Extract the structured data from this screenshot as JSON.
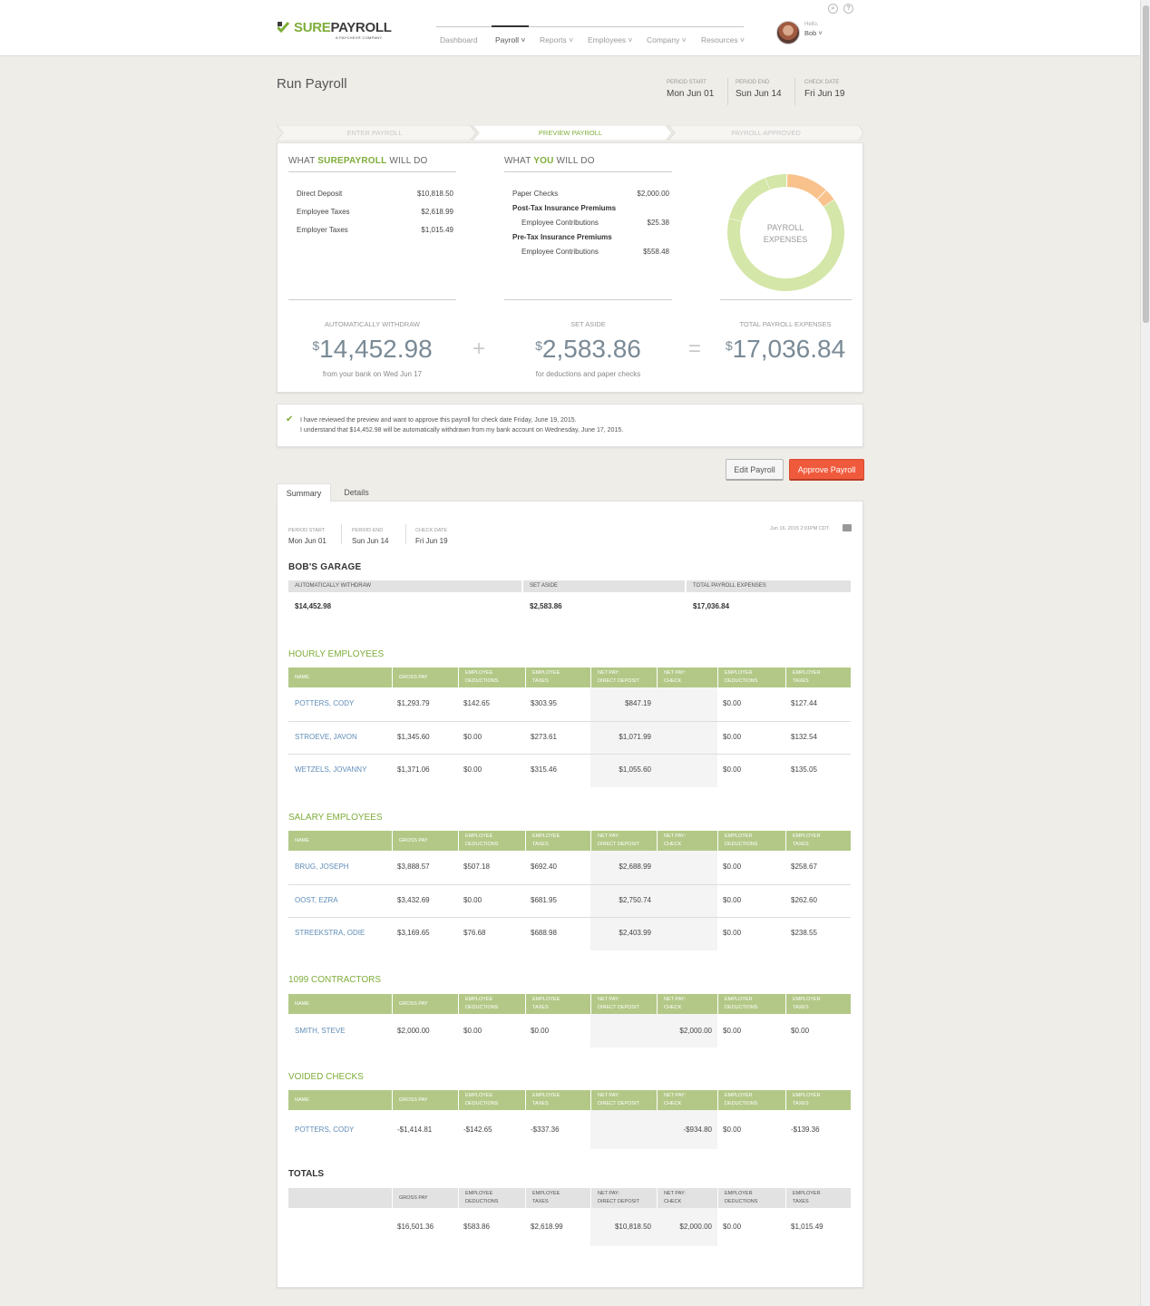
{
  "header": {
    "logo_sure": "SURE",
    "logo_payroll": "PAYROLL",
    "logo_sub": "A PAYCHEX® COMPANY",
    "nav": [
      {
        "label": "Dashboard"
      },
      {
        "label": "Payroll ˅"
      },
      {
        "label": "Reports ˅"
      },
      {
        "label": "Employees ˅"
      },
      {
        "label": "Company ˅"
      },
      {
        "label": "Resources ˅"
      }
    ],
    "hello": "Hello,",
    "user": "Bob ˅",
    "search_glyph": "⌕",
    "help_glyph": "?"
  },
  "page": {
    "title": "Run Payroll",
    "period_start_label": "PERIOD START",
    "period_start": "Mon Jun 01",
    "period_end_label": "PERIOD END",
    "period_end": "Sun Jun 14",
    "check_date_label": "CHECK DATE",
    "check_date": "Fri Jun 19"
  },
  "steps": [
    "ENTER PAYROLL",
    "PREVIEW PAYROLL",
    "PAYROLL APPROVED"
  ],
  "overview": {
    "sp_head_pre": "WHAT ",
    "sp_head_brand": "SUREPAYROLL",
    "sp_head_post": " WILL DO",
    "sp_rows": [
      {
        "label": "Direct Deposit",
        "value": "$10,818.50"
      },
      {
        "label": "Employee Taxes",
        "value": "$2,618.99"
      },
      {
        "label": "Employer Taxes",
        "value": "$1,015.49"
      }
    ],
    "you_head_pre": "WHAT ",
    "you_head_brand": "YOU",
    "you_head_post": " WILL DO",
    "you_rows": {
      "paper_checks_label": "Paper Checks",
      "paper_checks_value": "$2,000.00",
      "post_tax_label": "Post-Tax Insurance Premiums",
      "post_tax_contrib_label": "Employee Contributions",
      "post_tax_contrib_value": "$25.38",
      "pre_tax_label": "Pre-Tax Insurance Premiums",
      "pre_tax_contrib_label": "Employee Contributions",
      "pre_tax_contrib_value": "$558.48"
    },
    "donut_label_1": "PAYROLL",
    "donut_label_2": "EXPENSES",
    "withdraw_label": "AUTOMATICALLY WITHDRAW",
    "withdraw_value": "14,452.98",
    "withdraw_sub": "from your bank on Wed Jun 17",
    "plus": "+",
    "aside_label": "SET ASIDE",
    "aside_value": "2,583.86",
    "aside_sub": "for deductions and paper checks",
    "equals": "=",
    "total_label": "TOTAL PAYROLL EXPENSES",
    "total_value": "17,036.84",
    "currency": "$"
  },
  "chart_data": {
    "type": "pie",
    "title": "PAYROLL EXPENSES",
    "categories": [
      "Direct Deposit",
      "Employee Taxes",
      "Employer Taxes",
      "Paper Checks",
      "Post-Tax Employee Contributions",
      "Pre-Tax Employee Contributions"
    ],
    "values": [
      10818.5,
      2618.99,
      1015.49,
      2000.0,
      25.38,
      558.48
    ],
    "colors": [
      "#d4e6a8",
      "#d4e6a8",
      "#d4e6a8",
      "#f9c28c",
      "#f9c28c",
      "#f9c28c"
    ]
  },
  "confirm": {
    "check_glyph": "✔",
    "line1": "I have reviewed the preview and want to approve this payroll for check date Friday, June 19, 2015.",
    "line2": "I understand that $14,452.98 will be automatically withdrawn from my bank account on Wednesday, June 17, 2015."
  },
  "buttons": {
    "edit": "Edit Payroll",
    "approve": "Approve Payroll"
  },
  "tabs": [
    "Summary",
    "Details"
  ],
  "summary": {
    "period_start_label": "PERIOD START",
    "period_start": "Mon Jun 01",
    "period_end_label": "PERIOD END",
    "period_end": "Sun Jun 14",
    "check_date_label": "CHECK DATE",
    "check_date": "Fri Jun 19",
    "timestamp": "Jun 16, 2015 2:01PM CDT",
    "company": "BOB'S GARAGE",
    "totals_headers": [
      "AUTOMATICALLY WITHDRAW",
      "SET ASIDE",
      "TOTAL PAYROLL EXPENSES"
    ],
    "totals_values": [
      "$14,452.98",
      "$2,583.86",
      "$17,036.84"
    ]
  },
  "columns": {
    "name": "NAME",
    "gross": "GROSS PAY",
    "ee_ded_1": "EMPLOYEE",
    "ee_ded_2": "DEDUCTIONS",
    "ee_tax_1": "EMPLOYEE",
    "ee_tax_2": "TAXES",
    "net_dd_1": "NET PAY:",
    "net_dd_2": "DIRECT DEPOSIT",
    "net_ck_1": "NET PAY:",
    "net_ck_2": "CHECK",
    "er_ded_1": "EMPLOYER",
    "er_ded_2": "DEDUCTIONS",
    "er_tax_1": "EMPLOYER",
    "er_tax_2": "TAXES"
  },
  "hourly": {
    "title": "HOURLY EMPLOYEES",
    "rows": [
      {
        "name": "POTTERS, CODY",
        "gross": "$1,293.79",
        "ee_ded": "$142.65",
        "ee_tax": "$303.95",
        "net_dd": "$847.19",
        "net_ck": "",
        "er_ded": "$0.00",
        "er_tax": "$127.44"
      },
      {
        "name": "STROEVE, JAVON",
        "gross": "$1,345.60",
        "ee_ded": "$0.00",
        "ee_tax": "$273.61",
        "net_dd": "$1,071.99",
        "net_ck": "",
        "er_ded": "$0.00",
        "er_tax": "$132.54"
      },
      {
        "name": "WETZELS, JOVANNY",
        "gross": "$1,371.06",
        "ee_ded": "$0.00",
        "ee_tax": "$315.46",
        "net_dd": "$1,055.60",
        "net_ck": "",
        "er_ded": "$0.00",
        "er_tax": "$135.05"
      }
    ]
  },
  "salary": {
    "title": "SALARY EMPLOYEES",
    "rows": [
      {
        "name": "BRUG, JOSEPH",
        "gross": "$3,888.57",
        "ee_ded": "$507.18",
        "ee_tax": "$692.40",
        "net_dd": "$2,688.99",
        "net_ck": "",
        "er_ded": "$0.00",
        "er_tax": "$258.67"
      },
      {
        "name": "OOST, EZRA",
        "gross": "$3,432.69",
        "ee_ded": "$0.00",
        "ee_tax": "$681.95",
        "net_dd": "$2,750.74",
        "net_ck": "",
        "er_ded": "$0.00",
        "er_tax": "$262.60"
      },
      {
        "name": "STREEKSTRA, ODIE",
        "gross": "$3,169.65",
        "ee_ded": "$76.68",
        "ee_tax": "$688.98",
        "net_dd": "$2,403.99",
        "net_ck": "",
        "er_ded": "$0.00",
        "er_tax": "$238.55"
      }
    ]
  },
  "contractors": {
    "title": "1099 CONTRACTORS",
    "rows": [
      {
        "name": "SMITH, STEVE",
        "gross": "$2,000.00",
        "ee_ded": "$0.00",
        "ee_tax": "$0.00",
        "net_dd": "",
        "net_ck": "$2,000.00",
        "er_ded": "$0.00",
        "er_tax": "$0.00"
      }
    ]
  },
  "voided": {
    "title": "VOIDED CHECKS",
    "rows": [
      {
        "name": "POTTERS, CODY",
        "gross": "-$1,414.81",
        "ee_ded": "-$142.65",
        "ee_tax": "-$337.36",
        "net_dd": "",
        "net_ck": "-$934.80",
        "er_ded": "$0.00",
        "er_tax": "-$139.36"
      }
    ]
  },
  "totals": {
    "title": "TOTALS",
    "row": {
      "gross": "$16,501.36",
      "ee_ded": "$583.86",
      "ee_tax": "$2,618.99",
      "net_dd": "$10,818.50",
      "net_ck": "$2,000.00",
      "er_ded": "$0.00",
      "er_tax": "$1,015.49"
    }
  }
}
